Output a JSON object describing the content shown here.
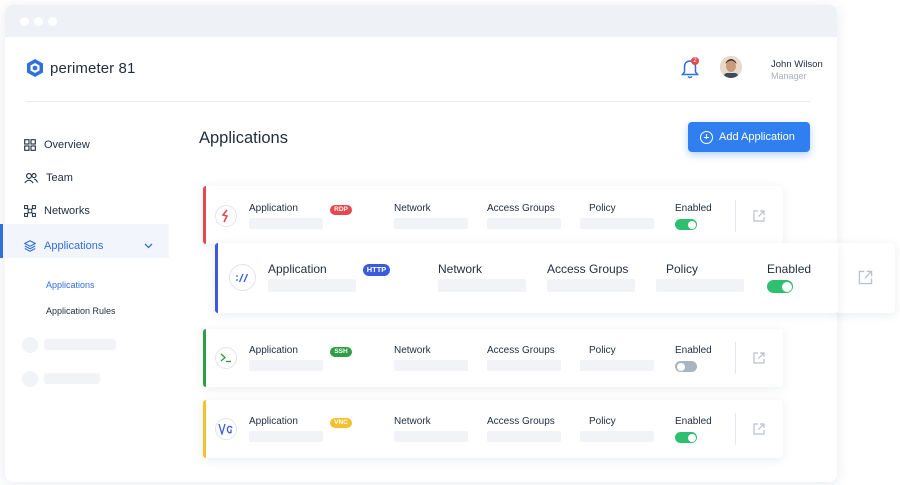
{
  "brand": {
    "name": "perimeter 81",
    "accent": "#2f7ff0"
  },
  "user": {
    "name": "John Wilson",
    "role": "Manager",
    "notifications": "2"
  },
  "nav": {
    "items": [
      {
        "id": "overview",
        "label": "Overview",
        "icon": "grid-icon"
      },
      {
        "id": "team",
        "label": "Team",
        "icon": "users-icon"
      },
      {
        "id": "networks",
        "label": "Networks",
        "icon": "network-icon"
      },
      {
        "id": "applications",
        "label": "Applications",
        "icon": "layers-icon",
        "active": true
      }
    ],
    "subitems": [
      {
        "label": "Applications",
        "active": true
      },
      {
        "label": "Application Rules",
        "active": false
      }
    ]
  },
  "page": {
    "title": "Applications",
    "add_button": "Add Application"
  },
  "columns": {
    "application": "Application",
    "network": "Network",
    "access_groups": "Access Groups",
    "policy": "Policy",
    "enabled": "Enabled"
  },
  "apps": [
    {
      "protocol": "RDP",
      "color": "#e5484d",
      "enabled": true,
      "icon": "rdp-icon"
    },
    {
      "protocol": "HTTP",
      "color": "#3b5bdb",
      "enabled": true,
      "icon": "http-icon"
    },
    {
      "protocol": "SSH",
      "color": "#2f9e44",
      "enabled": false,
      "icon": "terminal-icon"
    },
    {
      "protocol": "VNC",
      "color": "#f2c12e",
      "enabled": true,
      "icon": "vnc-icon"
    }
  ]
}
